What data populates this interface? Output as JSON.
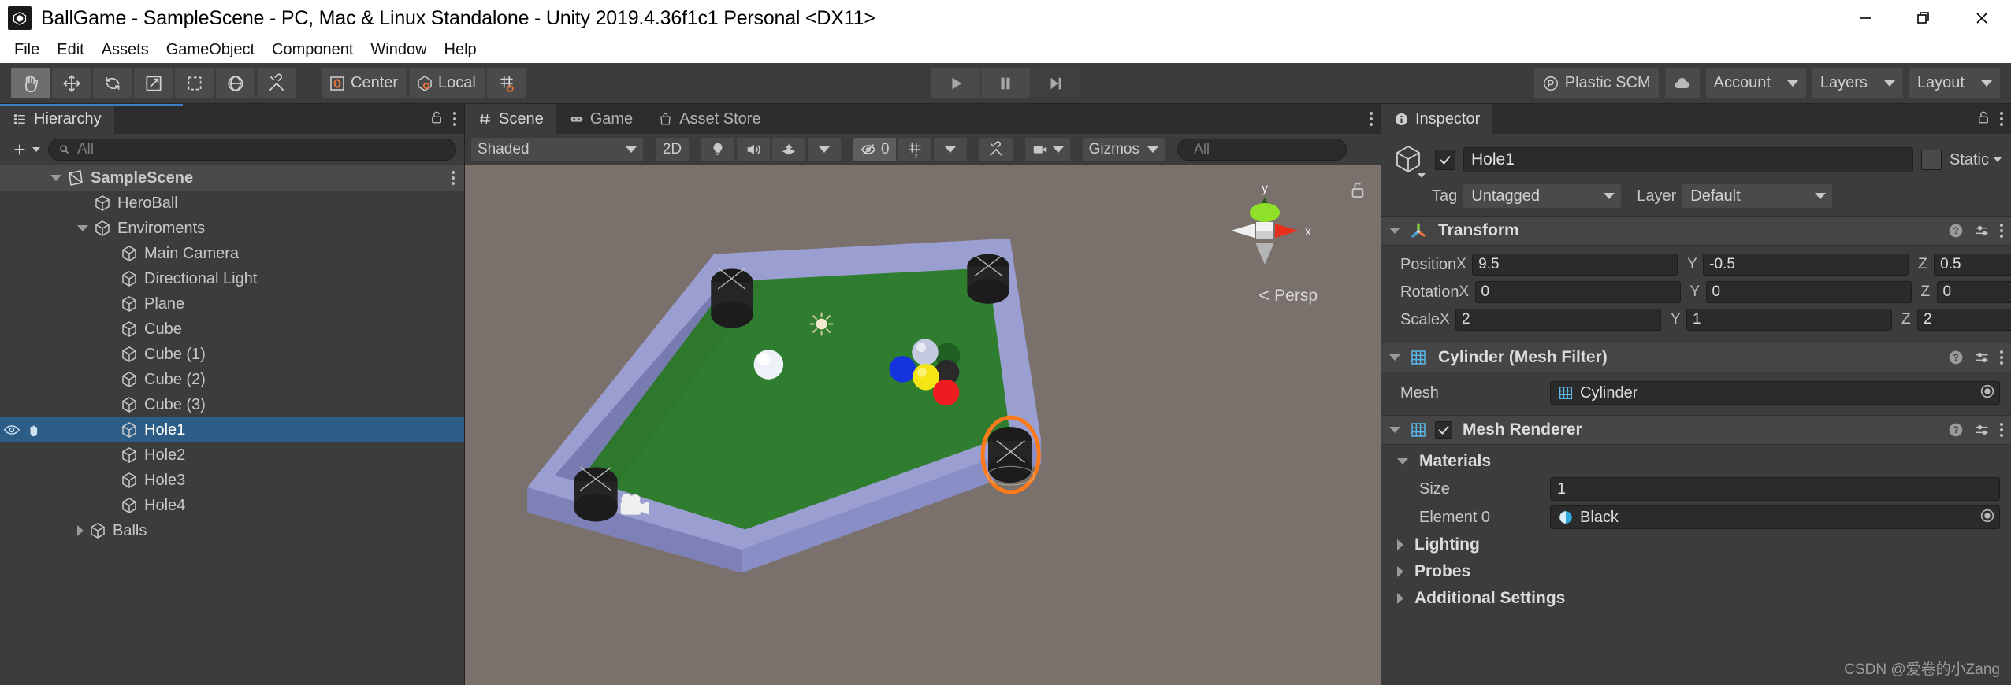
{
  "window": {
    "title": "BallGame - SampleScene - PC, Mac & Linux Standalone - Unity 2019.4.36f1c1 Personal <DX11>",
    "minimize_icon": "minimize-icon",
    "maximize_icon": "restore-icon",
    "close_icon": "close-icon"
  },
  "menubar": {
    "items": [
      {
        "label": "File"
      },
      {
        "label": "Edit"
      },
      {
        "label": "Assets"
      },
      {
        "label": "GameObject"
      },
      {
        "label": "Component"
      },
      {
        "label": "Window"
      },
      {
        "label": "Help"
      }
    ]
  },
  "toolbar": {
    "tools": [
      {
        "name": "hand-tool",
        "icon": "hand-icon",
        "active": true
      },
      {
        "name": "move-tool",
        "icon": "move-icon",
        "active": false
      },
      {
        "name": "rotate-tool",
        "icon": "rotate-icon",
        "active": false
      },
      {
        "name": "scale-tool",
        "icon": "scale-icon",
        "active": false
      },
      {
        "name": "rect-tool",
        "icon": "rect-transform-icon",
        "active": false
      },
      {
        "name": "transform-tool",
        "icon": "transform-icon",
        "active": false
      },
      {
        "name": "custom-tool",
        "icon": "wrench-icon",
        "active": false
      }
    ],
    "pivot_mode": "Center",
    "pivot_rotation": "Local",
    "snap_icon": "grid-snap-icon",
    "play": "play-icon",
    "pause": "pause-icon",
    "step": "step-icon",
    "plastic_scm": "Plastic SCM",
    "cloud_icon": "cloud-icon",
    "account": "Account",
    "layers": "Layers",
    "layout": "Layout"
  },
  "hierarchy": {
    "tab": "Hierarchy",
    "tab_icon": "hierarchy-icon",
    "create_label": "+",
    "search_placeholder": "All",
    "search_value": "",
    "items": [
      {
        "label": "SampleScene",
        "depth": 0,
        "icon": "scene-icon",
        "expander": "down",
        "selected": false,
        "is_scene": true
      },
      {
        "label": "HeroBall",
        "depth": 1,
        "icon": "gameobject-icon",
        "expander": "none",
        "selected": false
      },
      {
        "label": "Enviroments",
        "depth": 1,
        "icon": "gameobject-icon",
        "expander": "down",
        "selected": false
      },
      {
        "label": "Main Camera",
        "depth": 2,
        "icon": "gameobject-icon",
        "expander": "none",
        "selected": false
      },
      {
        "label": "Directional Light",
        "depth": 2,
        "icon": "gameobject-icon",
        "expander": "none",
        "selected": false
      },
      {
        "label": "Plane",
        "depth": 2,
        "icon": "gameobject-icon",
        "expander": "none",
        "selected": false
      },
      {
        "label": "Cube",
        "depth": 2,
        "icon": "gameobject-icon",
        "expander": "none",
        "selected": false
      },
      {
        "label": "Cube (1)",
        "depth": 2,
        "icon": "gameobject-icon",
        "expander": "none",
        "selected": false
      },
      {
        "label": "Cube (2)",
        "depth": 2,
        "icon": "gameobject-icon",
        "expander": "none",
        "selected": false
      },
      {
        "label": "Cube (3)",
        "depth": 2,
        "icon": "gameobject-icon",
        "expander": "none",
        "selected": false
      },
      {
        "label": "Hole1",
        "depth": 2,
        "icon": "gameobject-icon",
        "expander": "none",
        "selected": true
      },
      {
        "label": "Hole2",
        "depth": 2,
        "icon": "gameobject-icon",
        "expander": "none",
        "selected": false
      },
      {
        "label": "Hole3",
        "depth": 2,
        "icon": "gameobject-icon",
        "expander": "none",
        "selected": false
      },
      {
        "label": "Hole4",
        "depth": 2,
        "icon": "gameobject-icon",
        "expander": "none",
        "selected": false
      },
      {
        "label": "Balls",
        "depth": 1,
        "icon": "gameobject-icon",
        "expander": "right",
        "selected": false
      }
    ]
  },
  "scene": {
    "tabs": [
      {
        "label": "Scene",
        "icon": "scene-grid-icon",
        "active": true
      },
      {
        "label": "Game",
        "icon": "gamepad-icon",
        "active": false
      },
      {
        "label": "Asset Store",
        "icon": "store-bag-icon",
        "active": false
      }
    ],
    "draw_mode": "Shaded",
    "two_d": "2D",
    "lighting_icon": "light-bulb-icon",
    "audio_icon": "speaker-icon",
    "fx_icon": "effects-icon",
    "hidden_count": "0",
    "hidden_icon": "hidden-eye-icon",
    "grid_icon": "grid-visibility-icon",
    "component_tools_icon": "scene-tools-icon",
    "camera_icon": "scene-camera-icon",
    "gizmos": "Gizmos",
    "search_placeholder": "All",
    "search_value": "",
    "gizmo_axis_x": "x",
    "gizmo_axis_y": "y",
    "projection": "Persp",
    "lock_icon": "unlock-icon"
  },
  "inspector": {
    "tab": "Inspector",
    "tab_icon": "info-icon",
    "object_name": "Hole1",
    "object_enabled": true,
    "static_label": "Static",
    "static_checked": false,
    "tag_label": "Tag",
    "tag_value": "Untagged",
    "layer_label": "Layer",
    "layer_value": "Default",
    "transform": {
      "title": "Transform",
      "icon": "transform-axis-icon",
      "rows": [
        {
          "label": "Position",
          "x": "9.5",
          "y": "-0.5",
          "z": "0.5"
        },
        {
          "label": "Rotation",
          "x": "0",
          "y": "0",
          "z": "0"
        },
        {
          "label": "Scale",
          "x": "2",
          "y": "1",
          "z": "2"
        }
      ],
      "axis_x": "X",
      "axis_y": "Y",
      "axis_z": "Z"
    },
    "mesh_filter": {
      "title": "Cylinder (Mesh Filter)",
      "icon": "mesh-filter-icon",
      "mesh_label": "Mesh",
      "mesh_value": "Cylinder"
    },
    "mesh_renderer": {
      "title": "Mesh Renderer",
      "icon": "mesh-renderer-icon",
      "enabled": true,
      "materials_label": "Materials",
      "size_label": "Size",
      "size_value": "1",
      "element_label": "Element 0",
      "element_value": "Black",
      "lighting_label": "Lighting",
      "probes_label": "Probes",
      "additional_label": "Additional Settings"
    },
    "help_icon": "help-icon",
    "preset_icon": "preset-icon",
    "lock_icon": "unlock-icon"
  },
  "watermark": "CSDN @爱卷的小Zang",
  "colors": {
    "accent_blue": "#3d7ec2",
    "selection_blue": "#2c5d87",
    "panel_bg": "#3c3c3c",
    "viewport_bg": "#7b716c",
    "felt_green": "#2f7d2f",
    "rail_purple": "#9a9ed0",
    "highlight_orange": "#ff7a1a"
  }
}
